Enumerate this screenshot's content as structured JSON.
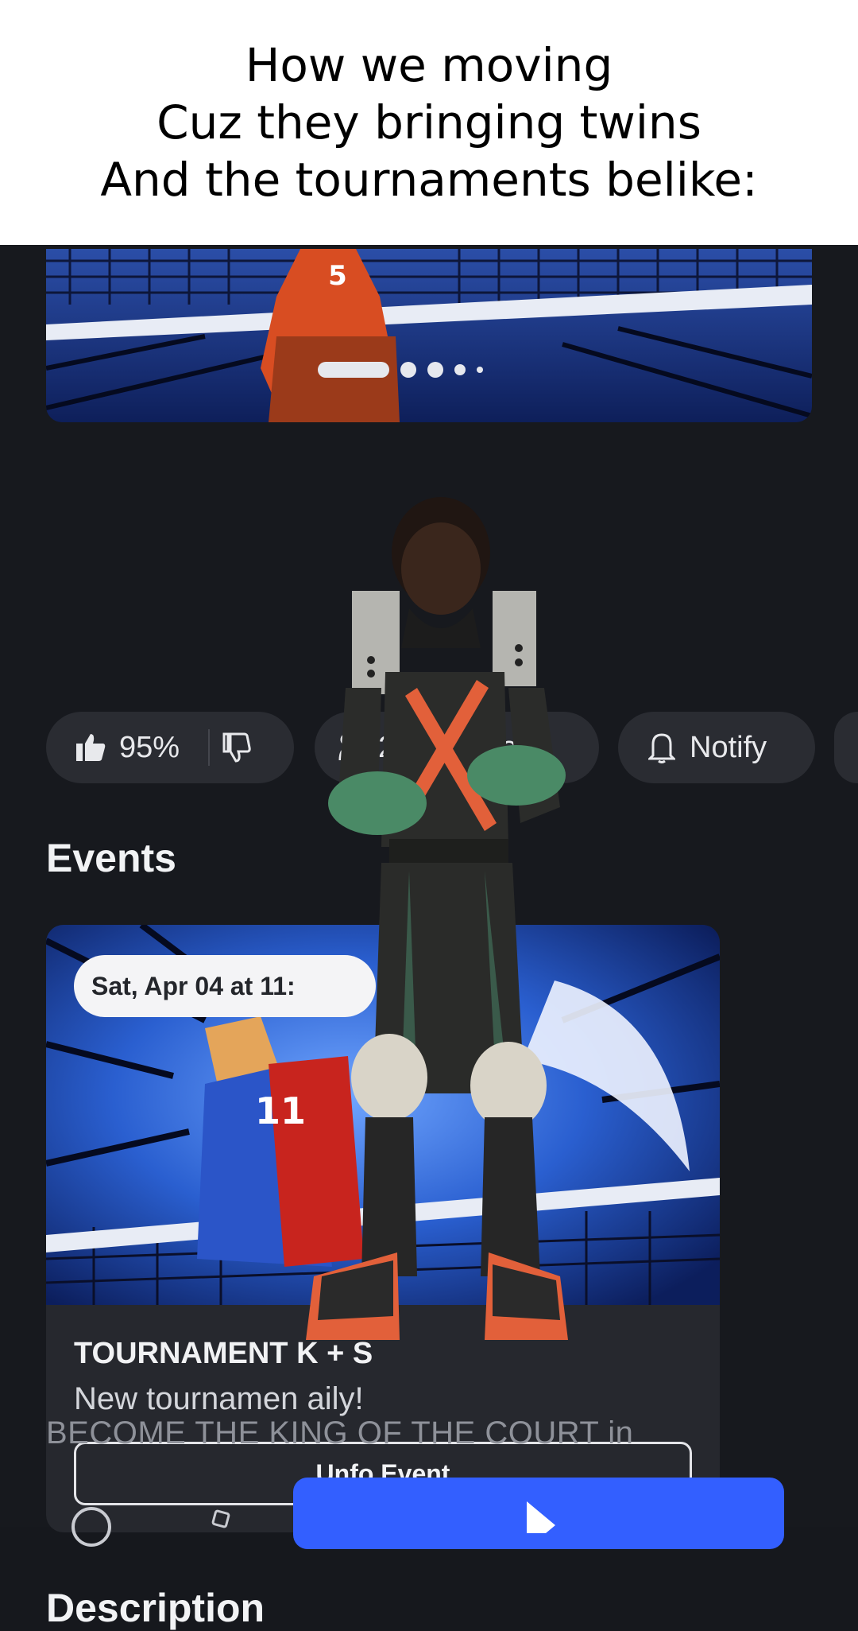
{
  "caption": {
    "line1": "How we moving",
    "line2": "Cuz they bringing twins",
    "line3": "And the tournaments belike:"
  },
  "banner": {
    "jersey_number": "5",
    "carousel_pages": 5,
    "carousel_active_index": 0
  },
  "stats": {
    "like_percent": "95%",
    "active_label": "2~~ active",
    "notify_label": "Notify"
  },
  "events": {
    "heading": "Events",
    "card": {
      "date": "Sat, Apr 04 at 11:",
      "jersey_number": "11",
      "title": "TOURNAMENT  K +  S",
      "subtitle": "New tournamen  aily!",
      "button": "Unfo   Event"
    }
  },
  "description": {
    "heading": "Description",
    "text": "BECOME THE KING OF THE COURT in"
  },
  "colors": {
    "background": "#17191e",
    "pill": "#2a2c32",
    "card": "#26282e",
    "play_button": "#335fff",
    "jersey_orange": "#e0542a"
  },
  "icons": {
    "like": "thumbs-up-icon",
    "dislike": "thumbs-down-icon",
    "active": "users-icon",
    "notify": "bell-icon",
    "play": "play-icon"
  }
}
